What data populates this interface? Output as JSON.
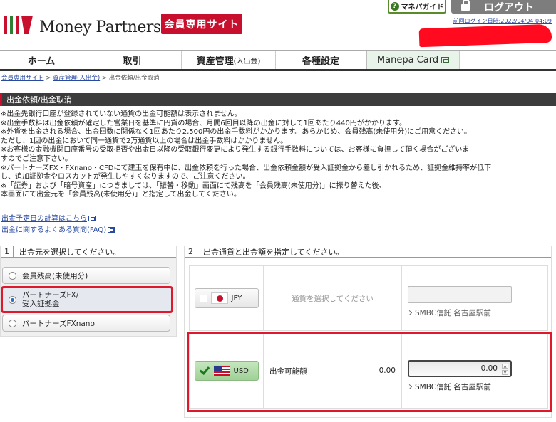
{
  "header": {
    "logo_text": "Money Partners",
    "member_site_badge": "会員専用サイト",
    "manepa_guide": "マネパガイド",
    "logout": "ログアウト",
    "last_login": "前回ログイン日時:2022/04/04 04:09"
  },
  "nav": {
    "items": [
      {
        "label": "ホーム"
      },
      {
        "label": "取引"
      },
      {
        "label": "資産管理",
        "sub": "(入出金)"
      },
      {
        "label": "各種設定"
      },
      {
        "label": "Manepa Card"
      }
    ]
  },
  "breadcrumb": {
    "items": [
      "会員専用サイト",
      "資産管理(入出金)",
      "出金依頼/出金取消"
    ],
    "separator": ">"
  },
  "section": {
    "title": "出金依頼/出金取消"
  },
  "notes": [
    "※出金先銀行口座が登録されていない通貨の出金可能額は表示されません。",
    "※出金手数料は出金依頼が確定した営業日を基準に円貨の場合、月間6回目以降の出金に対して1回あたり440円がかかります。",
    "※外貨を出金される場合、出金回数に関係なく1回あたり2,500円の出金手数料がかかります。あらかじめ、会員残高(未使用分)にご用意ください。",
    "ただし、1回の出金において同一通貨で2万通貨以上の場合は出金手数料はかかりません。",
    "※お客様の金融機関口座番号の受取拒否や出金日以降の受取銀行変更により発生する銀行手数料については、お客様に負担して頂く場合がございま",
    "すのでご注意下さい。",
    "※パートナーズFX・FXnano・CFDにて建玉を保有中に、出金依頼を行った場合、出金依頼金額が受入証拠金から差し引かれるため、証拠金維持率が低下",
    "し、追加証拠金やロスカットが発生しやすくなりますので、ご注意ください。",
    "※「証券」および「暗号資産」につきましては、「振替・移動」画面にて残高を「会員残高(未使用分)」に振り替えた後、",
    "本画面にて出金元を「会員残高(未使用分)」と指定して出金してください。"
  ],
  "links": {
    "schedule": "出金予定日の計算はこちら",
    "faq": "出金に関するよくある質問(FAQ)"
  },
  "step1": {
    "num": "1",
    "title": "出金元を選択してください。",
    "options": [
      {
        "label": "会員残高(未使用分)",
        "selected": false
      },
      {
        "label_line1": "パートナーズFX/",
        "label_line2": "受入証拠金",
        "selected": true
      },
      {
        "label": "パートナーズFXnano",
        "selected": false
      }
    ]
  },
  "step2": {
    "num": "2",
    "title": "出金通貨と出金額を指定してください。",
    "rows": [
      {
        "currency": "JPY",
        "checked": false,
        "message": "通貨を選択してください",
        "amount": "",
        "bank": "SMBC信託 名古屋駅前"
      },
      {
        "currency": "USD",
        "checked": true,
        "available_label": "出金可能額",
        "available_value": "0.00",
        "amount": "0.00",
        "bank": "SMBC信託 名古屋駅前"
      }
    ]
  },
  "colors": {
    "brand_red": "#c8102e",
    "highlight_red": "#e0182c",
    "link_blue": "#2a4aa0",
    "section_bar": "#3c3c3c",
    "active_currency_green": "#9fd196"
  }
}
